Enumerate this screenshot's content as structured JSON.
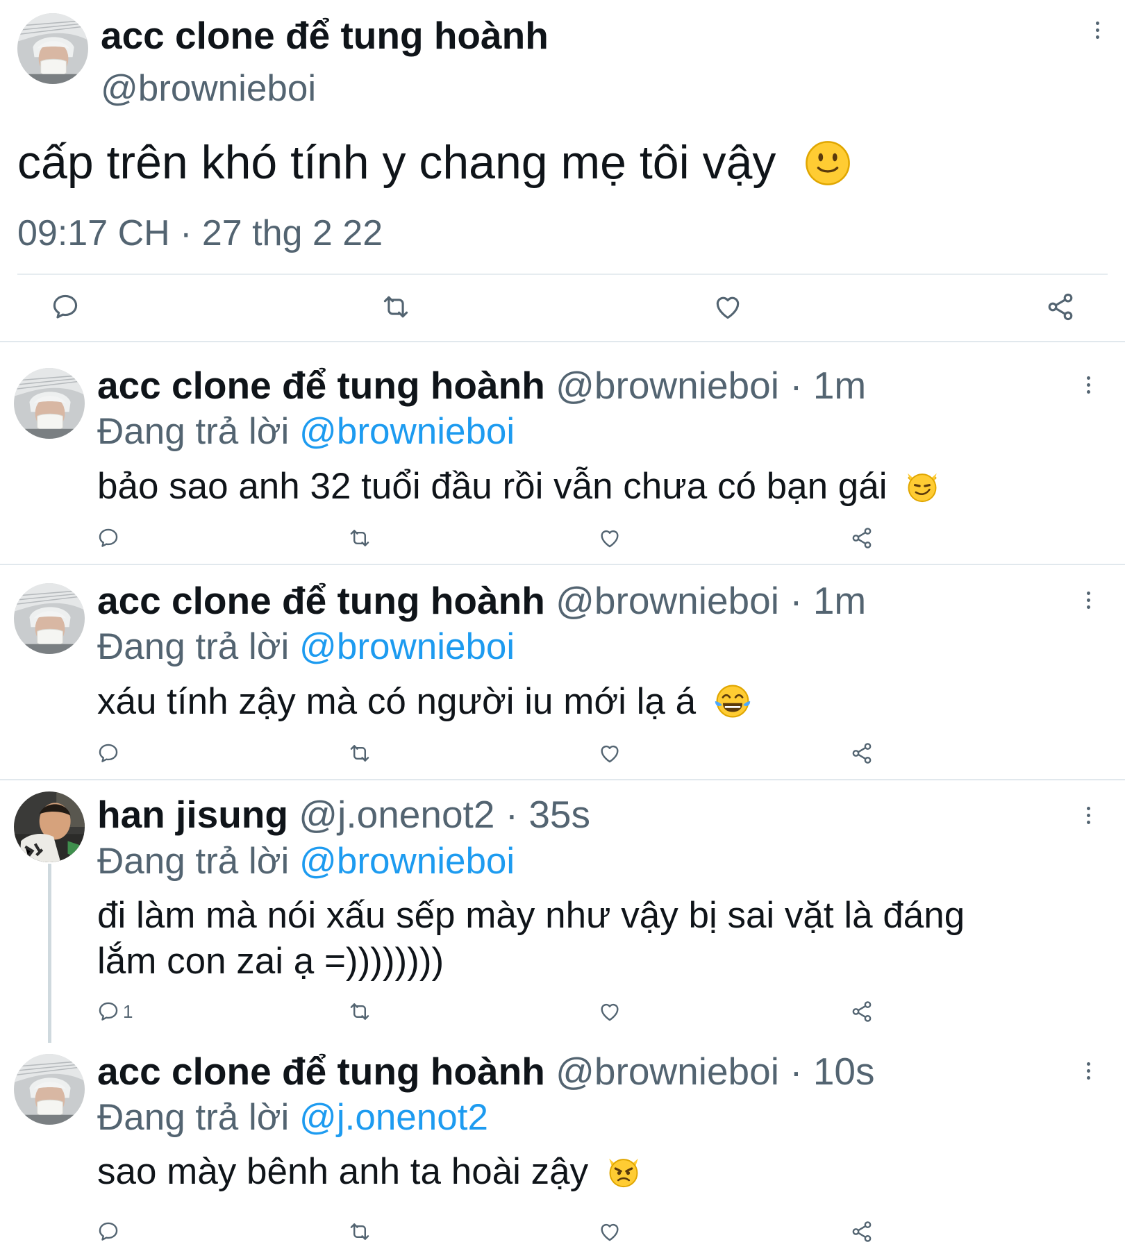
{
  "main_tweet": {
    "author_name": "acc clone để tung hoành",
    "handle": "@brownieboi",
    "text": "cấp trên khó tính y chang mẹ tôi vậy",
    "text_emoji": "slightly-smiling-face",
    "timestamp": "09:17 CH · 27 thg 2 22"
  },
  "replies": [
    {
      "author_name": "acc clone để tung hoành",
      "handle": "@brownieboi",
      "separator": "·",
      "time": "1m",
      "replying_prefix": "Đang trả lời",
      "replying_to": "@brownieboi",
      "text": "bảo sao anh 32 tuổi đầu rồi vẫn chưa có bạn gái",
      "text_emoji": "smirking-cat",
      "reply_count": ""
    },
    {
      "author_name": "acc clone để tung hoành",
      "handle": "@brownieboi",
      "separator": "·",
      "time": "1m",
      "replying_prefix": "Đang trả lời",
      "replying_to": "@brownieboi",
      "text": "xáu tính zậy mà có người iu mới lạ á",
      "text_emoji": "tears-of-joy",
      "reply_count": ""
    },
    {
      "author_name": "han jisung",
      "handle": "@j.onenot2",
      "separator": "·",
      "time": "35s",
      "replying_prefix": "Đang trả lời",
      "replying_to": "@brownieboi",
      "text_line1": "đi làm mà nói xấu sếp mày như vậy bị sai vặt là đáng",
      "text_line2": "lắm con zai ạ =))))))))",
      "reply_count": "1"
    },
    {
      "author_name": "acc clone để tung hoành",
      "handle": "@brownieboi",
      "separator": "·",
      "time": "10s",
      "replying_prefix": "Đang trả lời",
      "replying_to": "@j.onenot2",
      "text": "sao mày bênh anh ta hoài zậy",
      "text_emoji": "pouting-cat",
      "reply_count": ""
    }
  ],
  "colors": {
    "primary_text": "#0f1419",
    "secondary_text": "#536471",
    "link": "#1d9bf0",
    "divider": "#e1e8ed"
  },
  "icons": [
    "reply-icon",
    "retweet-icon",
    "like-icon",
    "share-icon",
    "more-icon"
  ]
}
